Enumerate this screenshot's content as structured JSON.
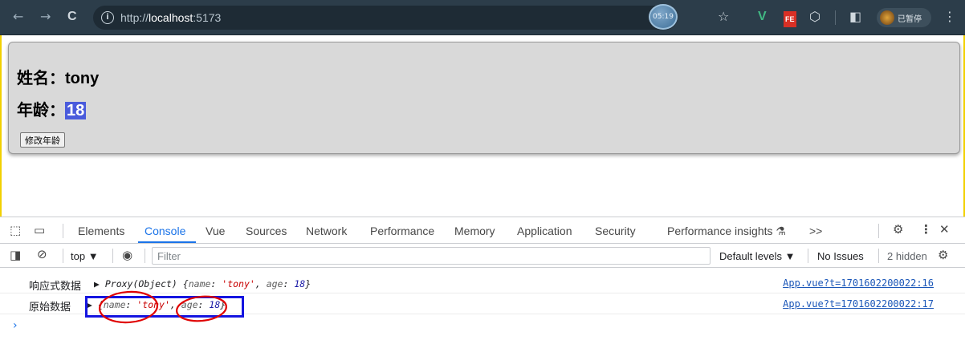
{
  "browser": {
    "back": "←",
    "forward": "→",
    "reload": "C",
    "url_scheme": "http://",
    "url_host": "localhost",
    "url_port": ":5173",
    "timer": "05:19",
    "star": "☆",
    "vue_ext": "V",
    "fe_ext": "FE",
    "puzzle": "⬡",
    "sidepanel": "◧",
    "profile_label": "已暂停",
    "menu": "⋮"
  },
  "page": {
    "name_label": "姓名：",
    "name_value": "tony",
    "age_label": "年龄：",
    "age_value": "18",
    "button_label": "修改年龄"
  },
  "devtools": {
    "tabs": [
      "Elements",
      "Console",
      "Vue",
      "Sources",
      "Network",
      "Performance",
      "Memory",
      "Application",
      "Security",
      "Performance insights"
    ],
    "active_tab": "Console",
    "more_tabs": ">>",
    "context": "top",
    "filter_placeholder": "Filter",
    "levels": "Default levels",
    "issues": "No Issues",
    "hidden": "2 hidden",
    "logs": [
      {
        "label": "响应式数据",
        "prefix": "▶ Proxy(Object) ",
        "name_key": "name",
        "name_val": "'tony'",
        "age_key": "age",
        "age_val": "18",
        "source": "App.vue?t=1701602200022:16"
      },
      {
        "label": "原始数据",
        "prefix": "▶ ",
        "name_key": "name",
        "name_val": "'tony'",
        "age_key": "age",
        "age_val": "18",
        "source": "App.vue?t=1701602200022:17"
      }
    ],
    "prompt": "›"
  },
  "colors": {
    "chrome_bg": "#2c3d4a",
    "accent": "#1a73e8",
    "highlight_box": "#1515e0",
    "annotation": "#e00000",
    "age_highlight": "#4a5bdc"
  }
}
